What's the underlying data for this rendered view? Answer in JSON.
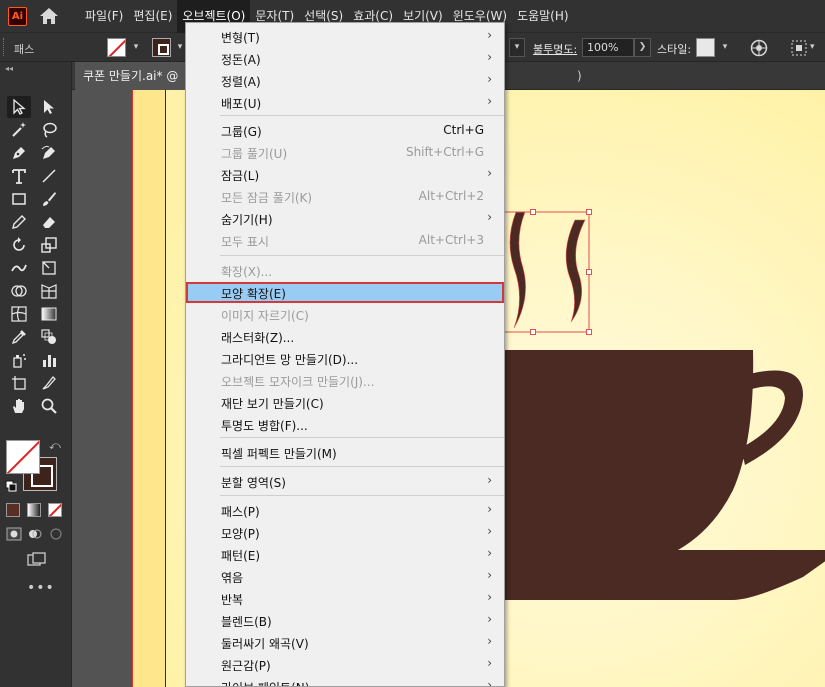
{
  "app": {
    "logo": "Ai"
  },
  "menubar": {
    "items": [
      "파일(F)",
      "편집(E)",
      "오브젝트(O)",
      "문자(T)",
      "선택(S)",
      "효과(C)",
      "보기(V)",
      "윈도우(W)",
      "도움말(H)"
    ],
    "active_index": 2
  },
  "controlbar": {
    "path_label": "패스",
    "opacity_label": "불투명도:",
    "opacity_value": "100%",
    "style_label": "스타일:"
  },
  "document": {
    "tab_title": "쿠폰 만들기.ai* @",
    "tab_suffix": ")"
  },
  "colors": {
    "accent_highlight": "#99ccf5",
    "highlight_border": "#d23a3a",
    "artwork_brown": "#4a2a22",
    "artboard_yellow": "#fff7b8"
  },
  "object_menu": {
    "items": [
      {
        "label": "변형(T)",
        "submenu": true
      },
      {
        "label": "정돈(A)",
        "submenu": true
      },
      {
        "label": "정렬(A)",
        "submenu": true
      },
      {
        "label": "배포(U)",
        "submenu": true
      },
      {
        "label": "그룹(G)",
        "shortcut": "Ctrl+G"
      },
      {
        "label": "그룹 풀기(U)",
        "shortcut": "Shift+Ctrl+G",
        "disabled": true
      },
      {
        "label": "잠금(L)",
        "submenu": true
      },
      {
        "label": "모든 잠금 풀기(K)",
        "shortcut": "Alt+Ctrl+2",
        "disabled": true
      },
      {
        "label": "숨기기(H)",
        "submenu": true
      },
      {
        "label": "모두 표시",
        "shortcut": "Alt+Ctrl+3",
        "disabled": true
      },
      {
        "label": "확장(X)...",
        "disabled": true
      },
      {
        "label": "모양 확장(E)",
        "highlighted": true
      },
      {
        "label": "이미지 자르기(C)",
        "disabled": true
      },
      {
        "label": "래스터화(Z)..."
      },
      {
        "label": "그라디언트 망 만들기(D)..."
      },
      {
        "label": "오브젝트 모자이크 만들기(J)...",
        "disabled": true
      },
      {
        "label": "재단 보기 만들기(C)"
      },
      {
        "label": "투명도 병합(F)..."
      },
      {
        "label": "픽셀 퍼펙트 만들기(M)"
      },
      {
        "label": "분할 영역(S)",
        "submenu": true
      },
      {
        "label": "패스(P)",
        "submenu": true
      },
      {
        "label": "모양(P)",
        "submenu": true
      },
      {
        "label": "패턴(E)",
        "submenu": true
      },
      {
        "label": "엮음",
        "submenu": true
      },
      {
        "label": "반복",
        "submenu": true
      },
      {
        "label": "블렌드(B)",
        "submenu": true
      },
      {
        "label": "둘러싸기 왜곡(V)",
        "submenu": true
      },
      {
        "label": "원근감(P)",
        "submenu": true
      },
      {
        "label": "라이브 페인트(N)",
        "submenu": true
      }
    ]
  }
}
